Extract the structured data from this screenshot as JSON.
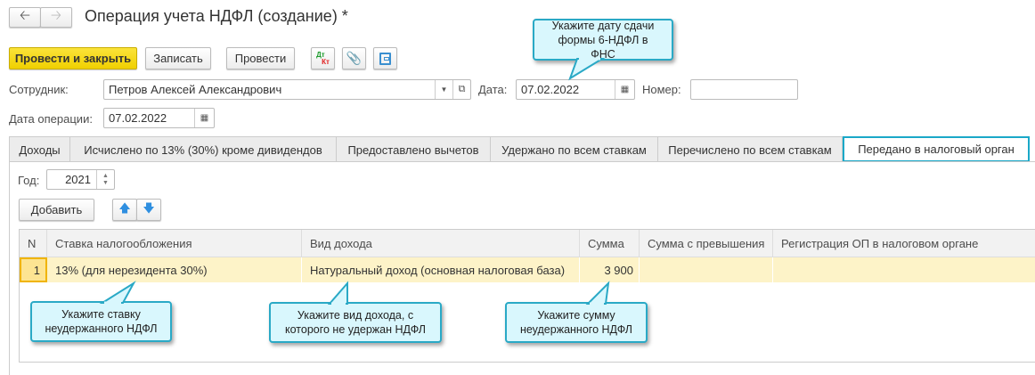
{
  "window": {
    "title": "Операция учета НДФЛ (создание) *"
  },
  "toolbar": {
    "post_close": "Провести и закрыть",
    "save": "Записать",
    "post": "Провести",
    "dt": "Дт",
    "kt": "Кт"
  },
  "form": {
    "employee_label": "Сотрудник:",
    "employee_value": "Петров Алексей Александрович",
    "date_label": "Дата:",
    "date_value": "07.02.2022",
    "number_label": "Номер:",
    "number_value": "",
    "op_date_label": "Дата операции:",
    "op_date_value": "07.02.2022"
  },
  "tabs": [
    {
      "label": "Доходы"
    },
    {
      "label": "Исчислено по 13% (30%) кроме дивидендов"
    },
    {
      "label": "Предоставлено вычетов"
    },
    {
      "label": "Удержано по всем ставкам"
    },
    {
      "label": "Перечислено по всем ставкам"
    },
    {
      "label": "Передано в налоговый орган",
      "active": true
    }
  ],
  "panel": {
    "year_label": "Год:",
    "year_value": "2021",
    "add_label": "Добавить"
  },
  "table": {
    "columns": [
      "N",
      "Ставка налогообложения",
      "Вид дохода",
      "Сумма",
      "Сумма с превышения",
      "Регистрация ОП в налоговом органе"
    ],
    "rows": [
      [
        "1",
        "13% (для нерезидента 30%)",
        "Натуральный доход (основная налоговая база)",
        "3 900",
        "",
        ""
      ]
    ]
  },
  "callouts": {
    "date": "Укажите дату сдачи формы 6-НДФЛ в ФНС",
    "rate": "Укажите ставку неудержанного НДФЛ",
    "income": "Укажите вид дохода, с которого не удержан НДФЛ",
    "sum": "Укажите сумму неудержанного НДФЛ"
  },
  "colors": {
    "primary_button": "#f5d80f",
    "accent": "#1aa8c8",
    "selected_row": "#fdf3c8",
    "callout_fill": "#d9f7fd"
  }
}
